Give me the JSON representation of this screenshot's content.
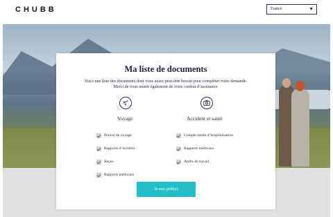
{
  "header": {
    "logo": "CHUBB",
    "country_select": {
      "value": "France",
      "icon": "chevron-down-icon"
    }
  },
  "card": {
    "title": "Ma liste de documents",
    "intro": "Voici une liste des documents dont vous aurez peut-être besoin pour compléter votre demande. Merci de vous munir également de votre contrat d’assurance.",
    "categories": [
      {
        "icon": "airplane-icon",
        "title": "Voyage",
        "items": [
          "Preuve de voyage",
          "Rapports d’incident",
          "Reçus",
          "Rapports médicaux"
        ]
      },
      {
        "icon": "camera-icon",
        "title": "Accident et santé",
        "items": [
          "Compte-rendu d’hospitalisation",
          "Rapports médicaux",
          "Arrêts de travail"
        ]
      }
    ],
    "ready_button": "Je suis prêt(e)"
  },
  "colors": {
    "accent": "#21bfc8",
    "text": "#1f1f3d",
    "band": "#e1e1e3"
  }
}
